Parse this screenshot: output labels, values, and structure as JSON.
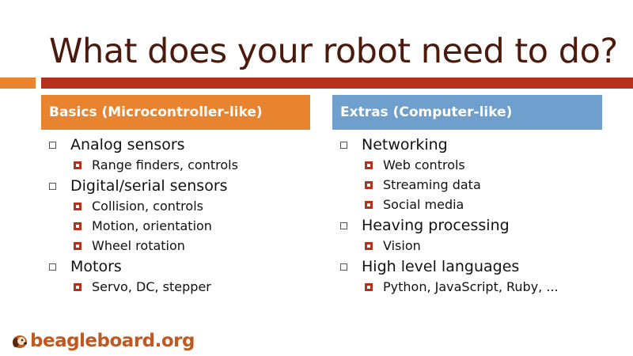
{
  "slide": {
    "title": "What does your robot need to do?"
  },
  "left_column": {
    "header": "Basics (Microcontroller-like)",
    "items": [
      {
        "label": "Analog sensors",
        "subitems": [
          "Range finders, controls"
        ]
      },
      {
        "label": "Digital/serial sensors",
        "subitems": [
          "Collision, controls",
          "Motion, orientation",
          "Wheel rotation"
        ]
      },
      {
        "label": "Motors",
        "subitems": [
          "Servo, DC, stepper"
        ]
      }
    ]
  },
  "right_column": {
    "header": "Extras (Computer-like)",
    "items": [
      {
        "label": "Networking",
        "subitems": [
          "Web controls",
          "Streaming data",
          "Social media"
        ]
      },
      {
        "label": "Heaving processing",
        "subitems": [
          "Vision"
        ]
      },
      {
        "label": "High level languages",
        "subitems": [
          "Python, JavaScript, Ruby, ..."
        ]
      }
    ]
  },
  "logo": {
    "text": "beagleboard.org"
  },
  "colors": {
    "accent_orange": "#e8832f",
    "accent_red": "#b5311d",
    "accent_blue": "#6f9fcd",
    "title_brown": "#4a1a0c"
  }
}
